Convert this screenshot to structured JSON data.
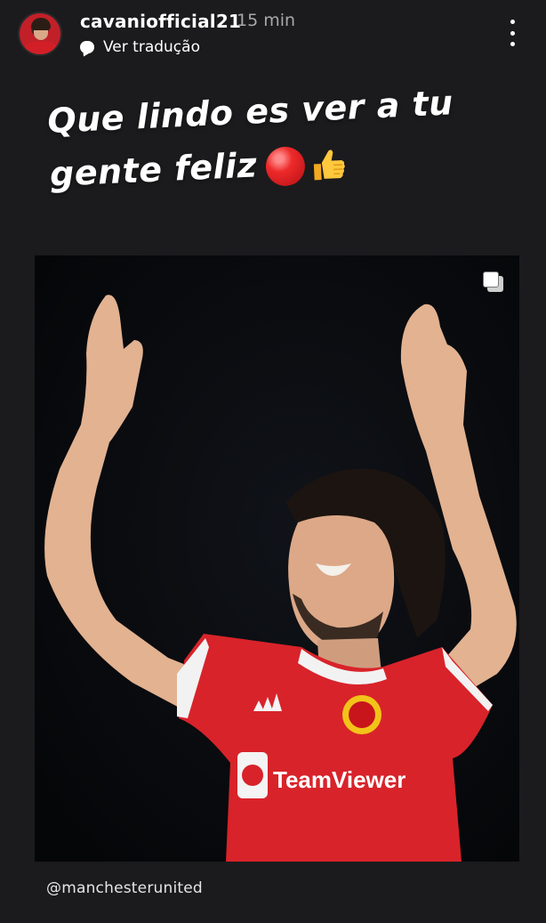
{
  "header": {
    "username": "cavaniofficial21",
    "time": "15 min",
    "translate_label": "Ver tradução"
  },
  "caption": {
    "line1": "Que lindo es ver a tu",
    "line2": "gente feliz"
  },
  "emojis": [
    "red-circle-icon",
    "thumbs-up-icon"
  ],
  "post": {
    "sponsor_text": "TeamViewer",
    "shirt_color": "#d8232a"
  },
  "mention": "@manchesterunited",
  "colors": {
    "background": "#1b1b1d",
    "post_background": "#07080b",
    "muted_text": "#a8a8aa"
  }
}
